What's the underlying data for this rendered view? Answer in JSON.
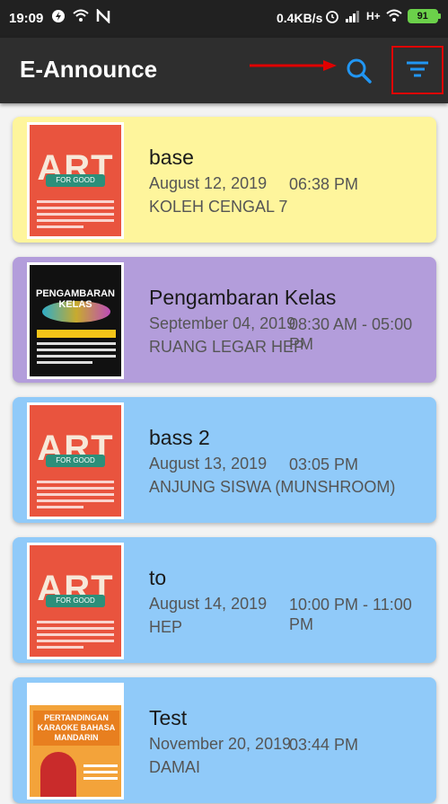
{
  "status_bar": {
    "time": "19:09",
    "network_speed": "0.4KB/s",
    "battery_level": "91"
  },
  "app_bar": {
    "title": "E-Announce",
    "icons": [
      "search-icon",
      "filter-icon"
    ]
  },
  "colors": {
    "card_yellow": "#fef59c",
    "card_purple": "#b39ddb",
    "card_blue": "#90caf9"
  },
  "announcements": [
    {
      "title": "base",
      "date": "August 12, 2019",
      "time": "06:38 PM",
      "venue": "KOLEH CENGAL 7",
      "color": "#fef59c",
      "poster": "art-for-good"
    },
    {
      "title": "Pengambaran Kelas",
      "date": "September 04, 2019",
      "time": "08:30 AM - 05:00 PM",
      "venue": "RUANG LEGAR HEP",
      "color": "#b39ddb",
      "poster": "pengambaran-kelas"
    },
    {
      "title": "bass 2",
      "date": "August 13, 2019",
      "time": "03:05 PM",
      "venue": "ANJUNG SISWA (MUNSHROOM)",
      "color": "#90caf9",
      "poster": "art-for-good"
    },
    {
      "title": "to",
      "date": "August 14, 2019",
      "time": "10:00 PM - 11:00 PM",
      "venue": "HEP",
      "color": "#90caf9",
      "poster": "art-for-good"
    },
    {
      "title": "Test",
      "date": "November 20, 2019",
      "time": "03:44 PM",
      "venue": "DAMAI",
      "color": "#90caf9",
      "poster": "karaoke-mandarin"
    }
  ],
  "posters": {
    "art_big": "ART",
    "art_ribbon": "FOR GOOD",
    "pk_heading": "PENGAMBARAN KELAS",
    "karaoke_title": "PERTANDINGAN KARAOKE BAHASA MANDARIN"
  }
}
